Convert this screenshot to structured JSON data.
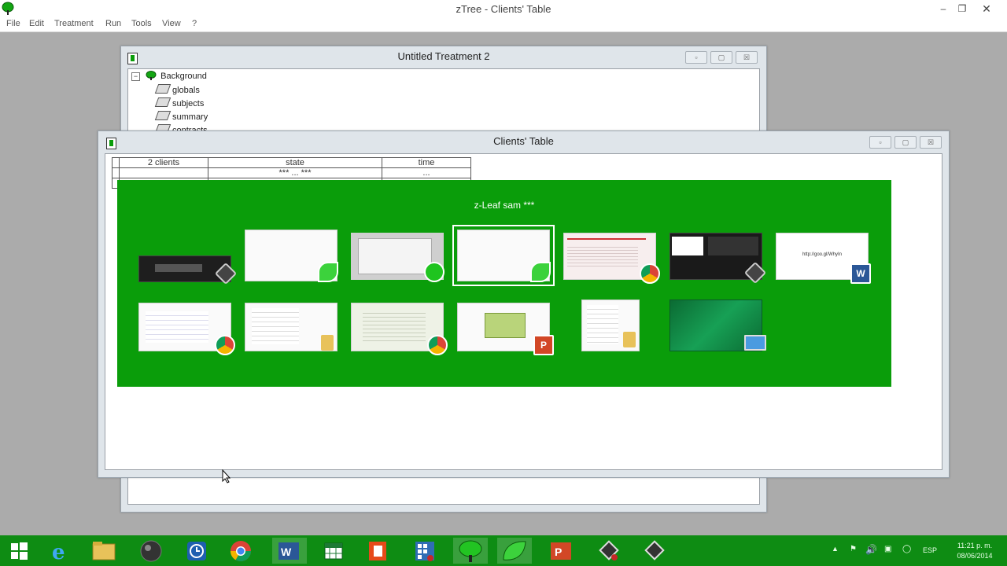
{
  "app": {
    "title": "zTree - Clients' Table",
    "menu": [
      "File",
      "Edit",
      "Treatment",
      "Run",
      "Tools",
      "View",
      "?"
    ]
  },
  "treatment_window": {
    "title": "Untitled Treatment 2",
    "tree": {
      "root": "Background",
      "children": [
        "globals",
        "subjects",
        "summary",
        "contracts"
      ]
    }
  },
  "clients_window": {
    "title": "Clients' Table",
    "table": {
      "headers": [
        "2 clients",
        "state",
        "time"
      ],
      "rows": [
        [
          "",
          "*** ... ***",
          "..."
        ],
        [
          "",
          "",
          ""
        ]
      ]
    }
  },
  "switcher": {
    "label": "z-Leaf sam ***",
    "row1": [
      {
        "name": "thumb-dark-app",
        "badge": "ztree-badge-icon",
        "color": "#1e1e1e"
      },
      {
        "name": "thumb-blank-zleaf",
        "badge": "leaf-icon",
        "color": "#f4f4f4"
      },
      {
        "name": "thumb-ztree-window",
        "badge": "tree-icon",
        "color": "#e8e8e8"
      },
      {
        "name": "thumb-zleaf-selected",
        "badge": "leaf-icon",
        "color": "#f4f4f4"
      },
      {
        "name": "thumb-chrome-page",
        "badge": "chrome-icon",
        "color": "#f7eeee"
      },
      {
        "name": "thumb-video-editor",
        "badge": "ztree-badge-icon",
        "color": "#2a2a2a"
      },
      {
        "name": "thumb-word-doc",
        "badge": "word-icon",
        "color": "#ffffff",
        "text": "http://goo.gl/WhyIn"
      }
    ],
    "row2": [
      {
        "name": "thumb-chrome-list",
        "badge": "chrome-icon",
        "color": "#ffffff"
      },
      {
        "name": "thumb-explorer",
        "badge": "folder-icon",
        "color": "#ffffff"
      },
      {
        "name": "thumb-chrome-forum",
        "badge": "chrome-icon",
        "color": "#eef2e6"
      },
      {
        "name": "thumb-powerpoint",
        "badge": "powerpoint-icon",
        "color": "#fafafa"
      },
      {
        "name": "thumb-explorer-2",
        "badge": "folder-icon",
        "color": "#ffffff"
      },
      {
        "name": "thumb-desktop",
        "badge": "desktop-icon",
        "color": "#0d7a3a"
      }
    ]
  },
  "taskbar": {
    "items": [
      "start-icon",
      "ie-icon",
      "explorer-icon",
      "media-icon",
      "clock-app-icon",
      "chrome-icon",
      "word-icon",
      "excel-icon",
      "office-icon",
      "calculator-icon",
      "ztree-icon",
      "zleaf-icon",
      "powerpoint-icon",
      "ztree-badge-icon",
      "video-icon"
    ],
    "language": "ESP",
    "time": "11:21 p. m.",
    "date": "08/06/2014"
  },
  "colors": {
    "switcher_bg": "#0a9d0a",
    "taskbar_bg": "#0e8c13",
    "desktop_bg": "#ababab"
  }
}
